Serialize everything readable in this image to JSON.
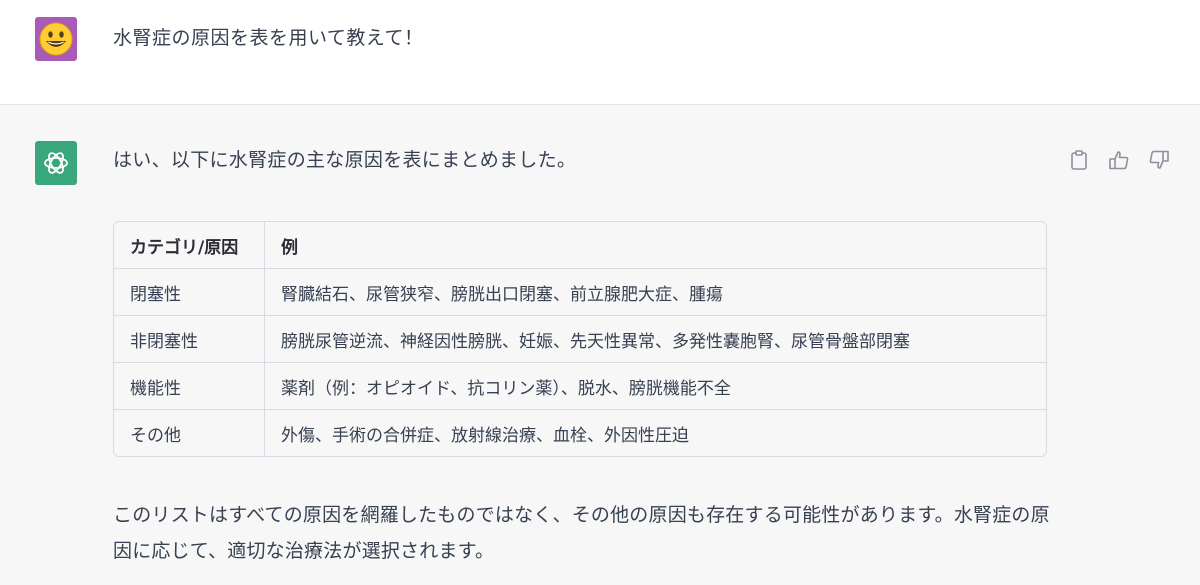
{
  "conversation": {
    "user_message": "水腎症の原因を表を用いて教えて！",
    "assistant_intro": "はい、以下に水腎症の主な原因を表にまとめました。",
    "assistant_outro": "このリストはすべての原因を網羅したものではなく、その他の原因も存在する可能性があります。水腎症の原因に応じて、適切な治療法が選択されます。"
  },
  "avatars": {
    "user_icon": "smiley-face-icon",
    "assistant_icon": "chatgpt-logo-icon",
    "user_bg": "#a95bb5",
    "assistant_bg": "#3aa67c"
  },
  "actions": [
    "copy-icon",
    "thumbs-up-icon",
    "thumbs-down-icon"
  ],
  "table": {
    "headers": [
      "カテゴリ/原因",
      "例"
    ],
    "rows": [
      [
        "閉塞性",
        "腎臓結石、尿管狭窄、膀胱出口閉塞、前立腺肥大症、腫瘍"
      ],
      [
        "非閉塞性",
        "膀胱尿管逆流、神経因性膀胱、妊娠、先天性異常、多発性嚢胞腎、尿管骨盤部閉塞"
      ],
      [
        "機能性",
        "薬剤（例：オピオイド、抗コリン薬）、脱水、膀胱機能不全"
      ],
      [
        "その他",
        "外傷、手術の合併症、放射線治療、血栓、外因性圧迫"
      ]
    ]
  }
}
